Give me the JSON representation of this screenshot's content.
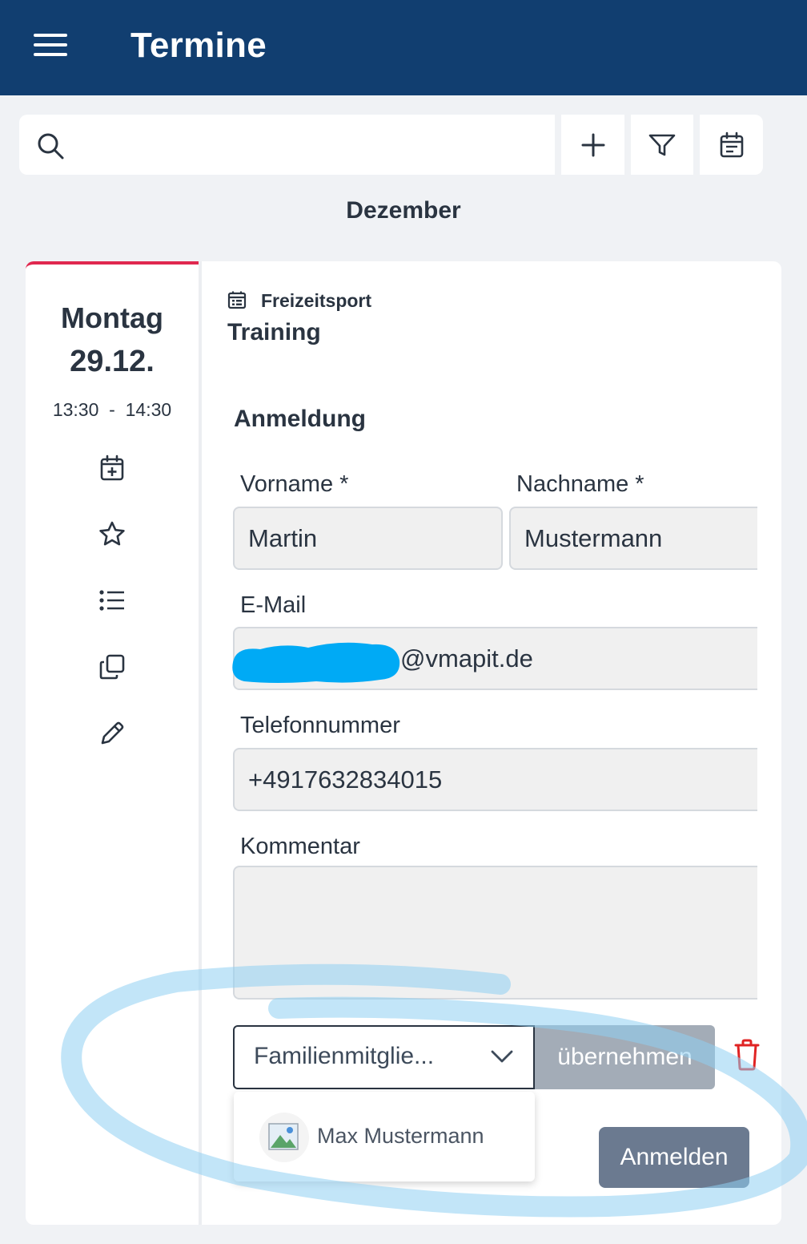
{
  "header": {
    "title": "Termine",
    "menu_icon": "hamburger-menu-icon"
  },
  "toolbar": {
    "search_placeholder": "",
    "search_value": "",
    "add_icon": "plus-icon",
    "filter_icon": "filter-icon",
    "calendar_icon": "calendar-icon"
  },
  "month": "Dezember",
  "event": {
    "weekday": "Montag",
    "date": "29.12.",
    "start": "13:30",
    "separator": "-",
    "end": "14:30",
    "category": "Freizeitsport",
    "title": "Training",
    "accent_color": "#e0284f",
    "side_actions": [
      "calendar-add-icon",
      "star-icon",
      "list-icon",
      "copy-icon",
      "pencil-icon"
    ]
  },
  "form": {
    "heading": "Anmeldung",
    "firstname_label": "Vorname *",
    "firstname_value": "Martin",
    "lastname_label": "Nachname *",
    "lastname_value": "Mustermann",
    "email_label": "E-Mail",
    "email_value": "@vmapit.de",
    "phone_label": "Telefonnummer",
    "phone_value": "+4917632834015",
    "comment_label": "Kommentar",
    "comment_value": "",
    "family_select_value": "Familienmitglie...",
    "apply_label": "übernehmen",
    "family_options": [
      "Max Mustermann"
    ],
    "submit_label": "Anmelden"
  },
  "colors": {
    "header_bg": "#113e70",
    "page_bg": "#f0f2f5",
    "submit_bg": "#6b7a90",
    "apply_bg": "#a3acb7",
    "delete_icon": "#e02424",
    "annotation": "#8fd0f2",
    "redaction": "#00aaf5"
  }
}
